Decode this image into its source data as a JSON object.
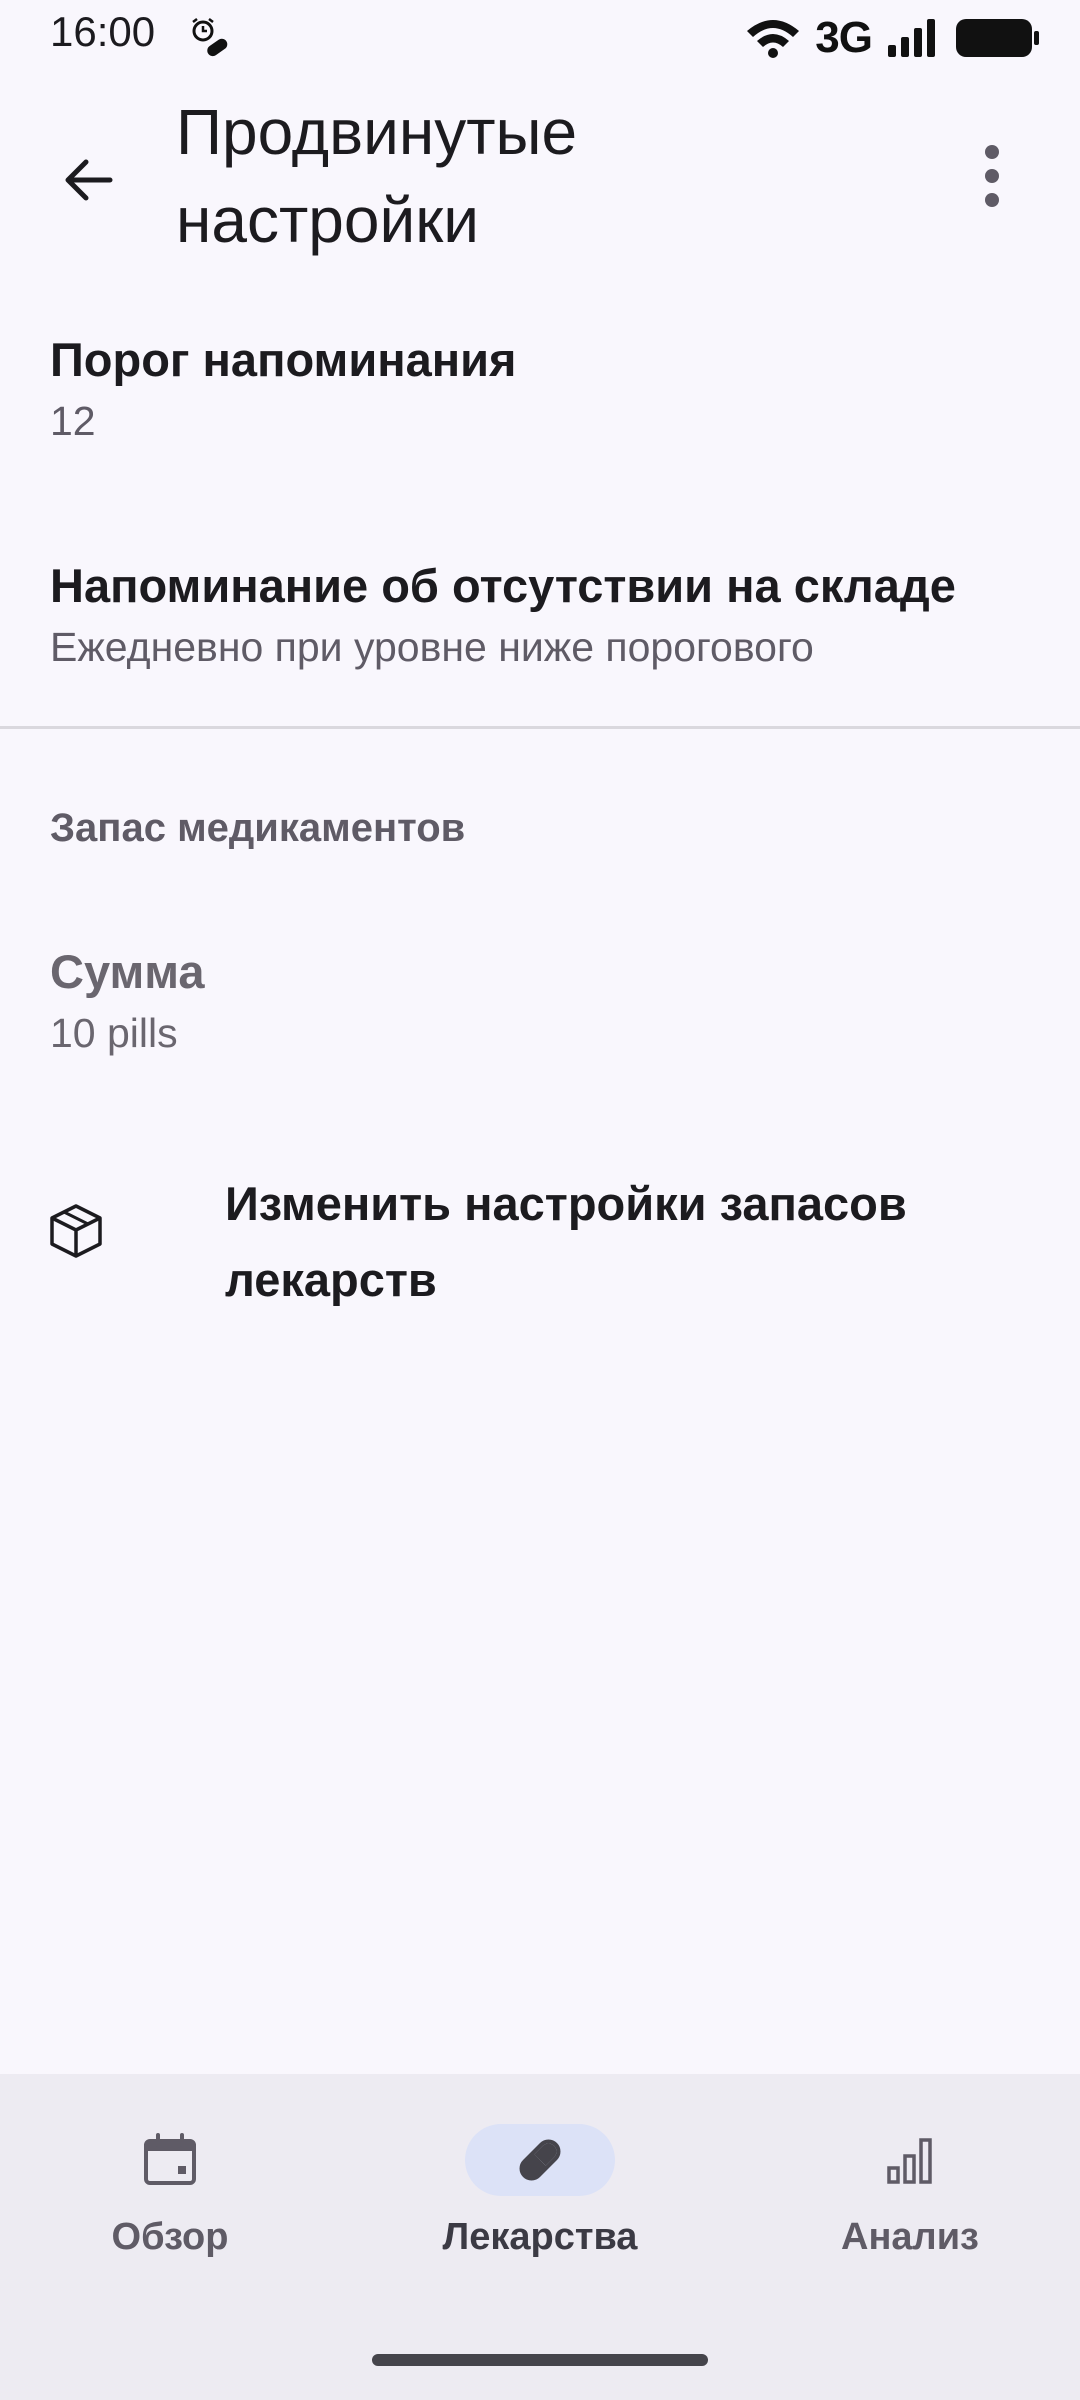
{
  "status_bar": {
    "time": "16:00",
    "network": "3G",
    "icons": [
      "alarm-icon",
      "pill-notification-icon",
      "wifi-icon",
      "signal-icon",
      "battery-icon"
    ]
  },
  "app_bar": {
    "title_line1": "Продвинутые",
    "title_line2": "настройки",
    "back_icon": "arrow-back-icon",
    "more_icon": "more-vert-icon"
  },
  "settings": {
    "reminder_threshold": {
      "title": "Порог напоминания",
      "value": "12"
    },
    "out_of_stock_reminder": {
      "title": "Напоминание об отсутствии на складе",
      "value": "Ежедневно при уровне ниже порогового"
    },
    "stock_section": {
      "header": "Запас медикаментов",
      "amount": {
        "title": "Сумма",
        "value": "10 pills"
      },
      "edit_stock": {
        "label": "Изменить настройки запасов лекарств",
        "icon": "package-icon"
      }
    }
  },
  "bottom_nav": {
    "items": [
      {
        "label": "Обзор",
        "icon": "calendar-icon",
        "active": false
      },
      {
        "label": "Лекарства",
        "icon": "pill-icon",
        "active": true
      },
      {
        "label": "Анализ",
        "icon": "bar-chart-icon",
        "active": false
      }
    ]
  },
  "colors": {
    "background": "#F9F7FD",
    "nav_background": "#EDEBF2",
    "active_indicator": "#DCE2F7",
    "text_primary": "#1C1B1F",
    "text_secondary": "#5F5B66"
  }
}
